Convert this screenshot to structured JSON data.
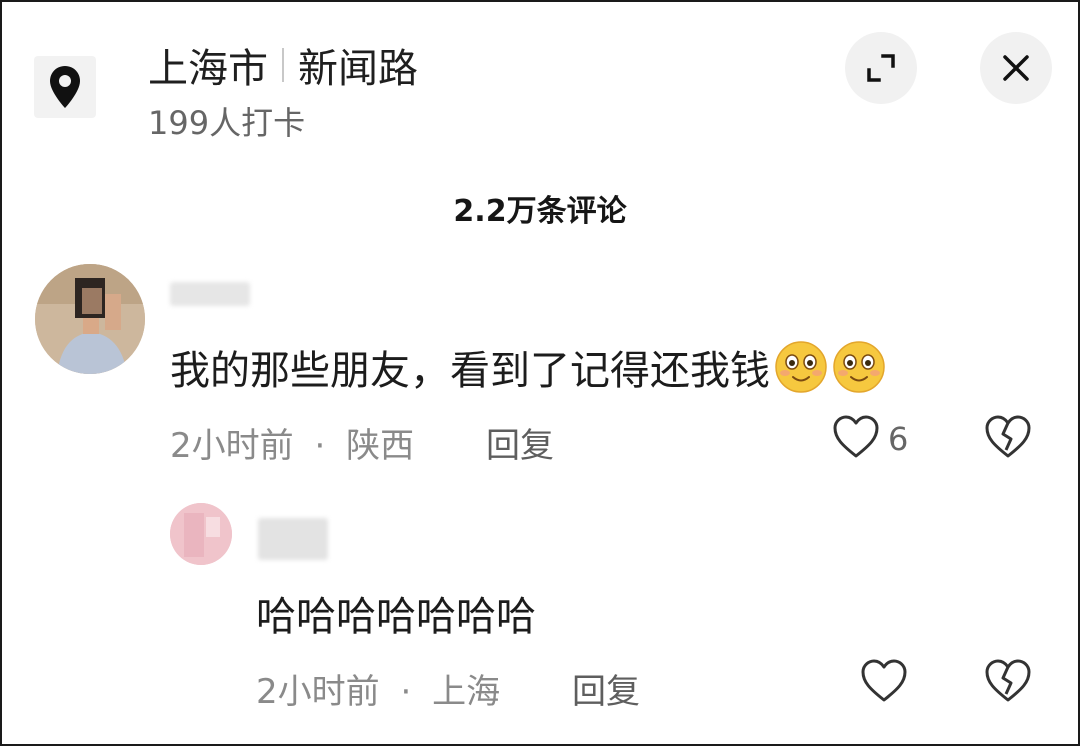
{
  "header": {
    "city": "上海市",
    "street": "新闻路",
    "checkins": "199人打卡",
    "location_icon": "map-pin-icon",
    "expand_icon": "expand-icon",
    "close_icon": "close-icon"
  },
  "comments_count": "2.2万条评论",
  "comments": [
    {
      "text": "我的那些朋友，看到了记得还我钱",
      "emojis": [
        "smile-emoji",
        "smile-emoji"
      ],
      "time": "2小时前",
      "sep": "·",
      "region": "陕西",
      "reply_label": "回复",
      "likes": "6"
    },
    {
      "text": "哈哈哈哈哈哈哈",
      "time": "2小时前",
      "sep": "·",
      "region": "上海",
      "reply_label": "回复",
      "likes": ""
    }
  ],
  "colors": {
    "text": "#1c1c1c",
    "muted": "#8a8a8a",
    "button_bg": "#f1f1f1"
  }
}
